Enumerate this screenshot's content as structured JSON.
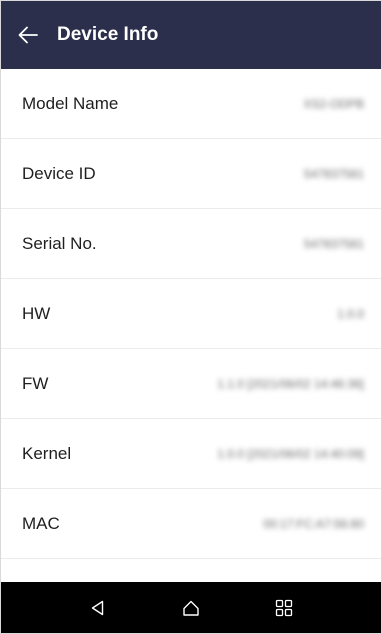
{
  "header": {
    "title": "Device Info",
    "back_icon": "arrow-left-icon"
  },
  "rows": [
    {
      "label": "Model Name",
      "value": "XS2-ODPB"
    },
    {
      "label": "Device ID",
      "value": "547837581"
    },
    {
      "label": "Serial No.",
      "value": "547837581"
    },
    {
      "label": "HW",
      "value": "1.0.0"
    },
    {
      "label": "FW",
      "value": "1.1.0 [2021/06/02 14:46:36]"
    },
    {
      "label": "Kernel",
      "value": "1.0.0 [2021/06/02 14:40:09]"
    },
    {
      "label": "MAC",
      "value": "00:17:FC:A7:56:80"
    }
  ],
  "navbar": {
    "back_icon": "triangle-back-icon",
    "home_icon": "home-icon",
    "recents_icon": "grid-recents-icon"
  },
  "colors": {
    "header_bg": "#2b2f4c",
    "navbar_bg": "#000000"
  }
}
